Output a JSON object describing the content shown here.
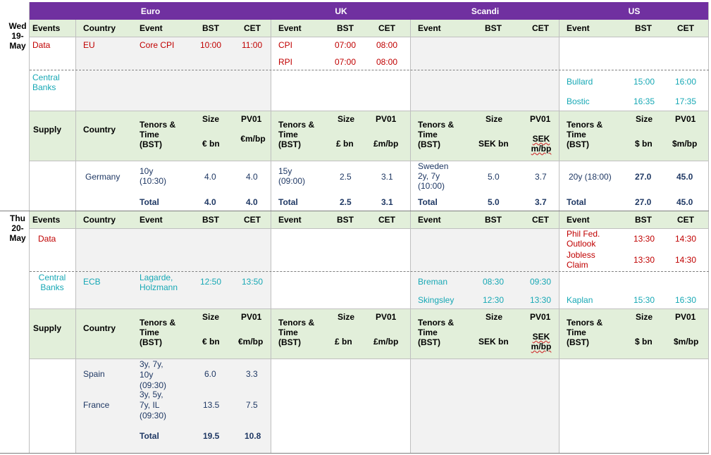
{
  "regions": [
    "Euro",
    "UK",
    "Scandi",
    "US"
  ],
  "days": [
    {
      "label": "Wed 19-May"
    },
    {
      "label": "Thu 20-May"
    }
  ],
  "events_header": {
    "events": "Events",
    "country": "Country",
    "event": "Event",
    "bst": "BST",
    "cet": "CET"
  },
  "supply_header": {
    "supply": "Supply",
    "country": "Country",
    "tenors": "Tenors & Time (BST)",
    "size": "Size",
    "pv01": "PV01",
    "units": {
      "euro_size": "€ bn",
      "euro_pv01_wed": "€m/bp",
      "euro_pv01_thu": "€m/bp",
      "uk_size": "£ bn",
      "uk_pv01": "£m/bp",
      "scandi_size": "SEK bn",
      "scandi_pv01": "SEK m/bp",
      "us_size": "$ bn",
      "us_pv01": "$m/bp"
    }
  },
  "row_labels": {
    "data": "Data",
    "central_banks": "Central Banks",
    "total": "Total"
  },
  "wed": {
    "data": {
      "euro": [
        {
          "country": "EU",
          "event": "Core CPI",
          "bst": "10:00",
          "cet": "11:00"
        }
      ],
      "uk": [
        {
          "event": "CPI",
          "bst": "07:00",
          "cet": "08:00"
        },
        {
          "event": "RPI",
          "bst": "07:00",
          "cet": "08:00"
        }
      ]
    },
    "central_banks": {
      "us": [
        {
          "event": "Bullard",
          "bst": "15:00",
          "cet": "16:00"
        },
        {
          "event": "Bostic",
          "bst": "16:35",
          "cet": "17:35"
        }
      ]
    },
    "supply": {
      "euro": {
        "country": "Germany",
        "tenor": "10y (10:30)",
        "size": "4.0",
        "pv01": "4.0",
        "total_size": "4.0",
        "total_pv01": "4.0"
      },
      "uk": {
        "tenor": "15y (09:00)",
        "size": "2.5",
        "pv01": "3.1",
        "total_size": "2.5",
        "total_pv01": "3.1"
      },
      "scandi": {
        "tenor": "Sweden 2y, 7y (10:00)",
        "size": "5.0",
        "pv01": "3.7",
        "total_size": "5.0",
        "total_pv01": "3.7"
      },
      "us": {
        "tenor": "20y (18:00)",
        "size": "27.0",
        "pv01": "45.0",
        "total_size": "27.0",
        "total_pv01": "45.0"
      }
    }
  },
  "thu": {
    "data": {
      "us": [
        {
          "event": "Phil Fed. Outlook",
          "bst": "13:30",
          "cet": "14:30"
        },
        {
          "event": "Jobless Claim",
          "bst": "13:30",
          "cet": "14:30"
        }
      ]
    },
    "central_banks": {
      "euro": [
        {
          "country": "ECB",
          "event": "Lagarde, Holzmann",
          "bst": "12:50",
          "cet": "13:50"
        }
      ],
      "scandi": [
        {
          "event": "Breman",
          "bst": "08:30",
          "cet": "09:30"
        },
        {
          "event": "Skingsley",
          "bst": "12:30",
          "cet": "13:30"
        }
      ],
      "us": [
        {
          "event": "Kaplan",
          "bst": "15:30",
          "cet": "16:30"
        }
      ]
    },
    "supply": {
      "euro": [
        {
          "country": "Spain",
          "tenor": "3y, 7y, 10y (09:30)",
          "size": "6.0",
          "pv01": "3.3"
        },
        {
          "country": "France",
          "tenor": "3y, 5y, 7y, IL (09:30)",
          "size": "13.5",
          "pv01": "7.5"
        }
      ],
      "euro_total": {
        "size": "19.5",
        "pv01": "10.8"
      }
    }
  }
}
